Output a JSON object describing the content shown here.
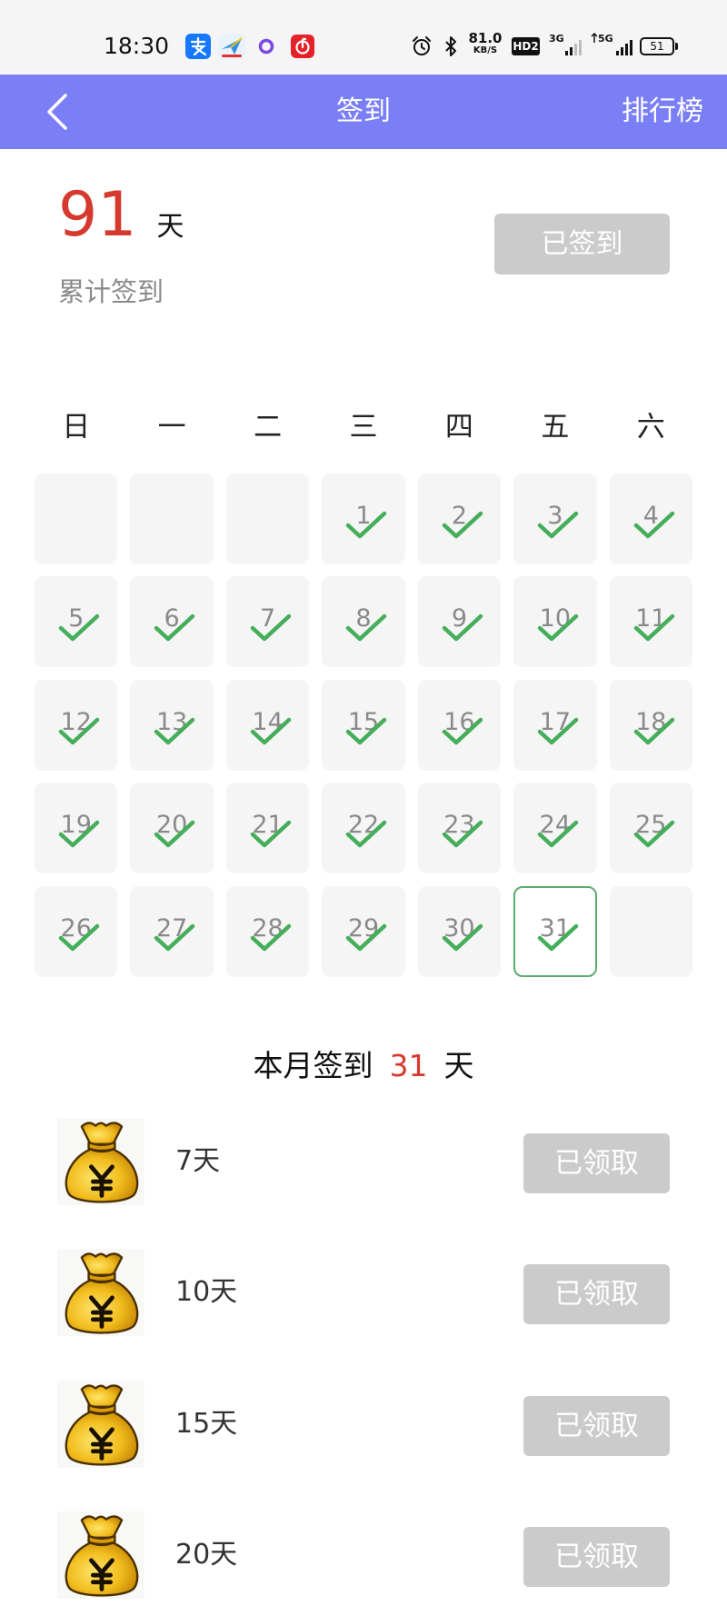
{
  "status_bar": {
    "time": "18:30",
    "net_speed_value": "81.0",
    "net_speed_unit": "KB/S",
    "hd_badge": "HD2",
    "sim1_network": "3G",
    "sim2_network": "5G",
    "battery_level": "51",
    "notification_icons": [
      "alipay-icon",
      "kite-app-icon",
      "purple-ring-app-icon",
      "netease-music-icon"
    ],
    "system_icons": [
      "alarm-icon",
      "bluetooth-icon",
      "signal-icon",
      "battery-icon"
    ]
  },
  "header": {
    "back_icon": "chevron-left-icon",
    "title": "签到",
    "action": "排行榜"
  },
  "summary": {
    "total_days": "91",
    "unit": "天",
    "label": "累计签到",
    "button": "已签到"
  },
  "calendar": {
    "weekdays": [
      "日",
      "一",
      "二",
      "三",
      "四",
      "五",
      "六"
    ],
    "weeks": [
      [
        null,
        null,
        null,
        {
          "day": "1",
          "signed": true
        },
        {
          "day": "2",
          "signed": true
        },
        {
          "day": "3",
          "signed": true
        },
        {
          "day": "4",
          "signed": true
        }
      ],
      [
        {
          "day": "5",
          "signed": true
        },
        {
          "day": "6",
          "signed": true
        },
        {
          "day": "7",
          "signed": true
        },
        {
          "day": "8",
          "signed": true
        },
        {
          "day": "9",
          "signed": true
        },
        {
          "day": "10",
          "signed": true
        },
        {
          "day": "11",
          "signed": true
        }
      ],
      [
        {
          "day": "12",
          "signed": true
        },
        {
          "day": "13",
          "signed": true
        },
        {
          "day": "14",
          "signed": true
        },
        {
          "day": "15",
          "signed": true
        },
        {
          "day": "16",
          "signed": true
        },
        {
          "day": "17",
          "signed": true
        },
        {
          "day": "18",
          "signed": true
        }
      ],
      [
        {
          "day": "19",
          "signed": true
        },
        {
          "day": "20",
          "signed": true
        },
        {
          "day": "21",
          "signed": true
        },
        {
          "day": "22",
          "signed": true
        },
        {
          "day": "23",
          "signed": true
        },
        {
          "day": "24",
          "signed": true
        },
        {
          "day": "25",
          "signed": true
        }
      ],
      [
        {
          "day": "26",
          "signed": true
        },
        {
          "day": "27",
          "signed": true
        },
        {
          "day": "28",
          "signed": true
        },
        {
          "day": "29",
          "signed": true
        },
        {
          "day": "30",
          "signed": true
        },
        {
          "day": "31",
          "signed": true,
          "today": true
        },
        null
      ]
    ]
  },
  "month_summary": {
    "prefix": "本月签到",
    "count": "31",
    "suffix": "天"
  },
  "rewards": [
    {
      "icon": "money-bag-icon",
      "label": "7天",
      "button": "已领取"
    },
    {
      "icon": "money-bag-icon",
      "label": "10天",
      "button": "已领取"
    },
    {
      "icon": "money-bag-icon",
      "label": "15天",
      "button": "已领取"
    },
    {
      "icon": "money-bag-icon",
      "label": "20天",
      "button": "已领取"
    }
  ],
  "colors": {
    "header_bg": "#7b7ff6",
    "accent_red": "#d63a2f",
    "check_green": "#45ae5a",
    "today_border": "#5cab6e",
    "button_disabled": "#cbcbcb",
    "cell_bg": "#f5f5f5"
  }
}
